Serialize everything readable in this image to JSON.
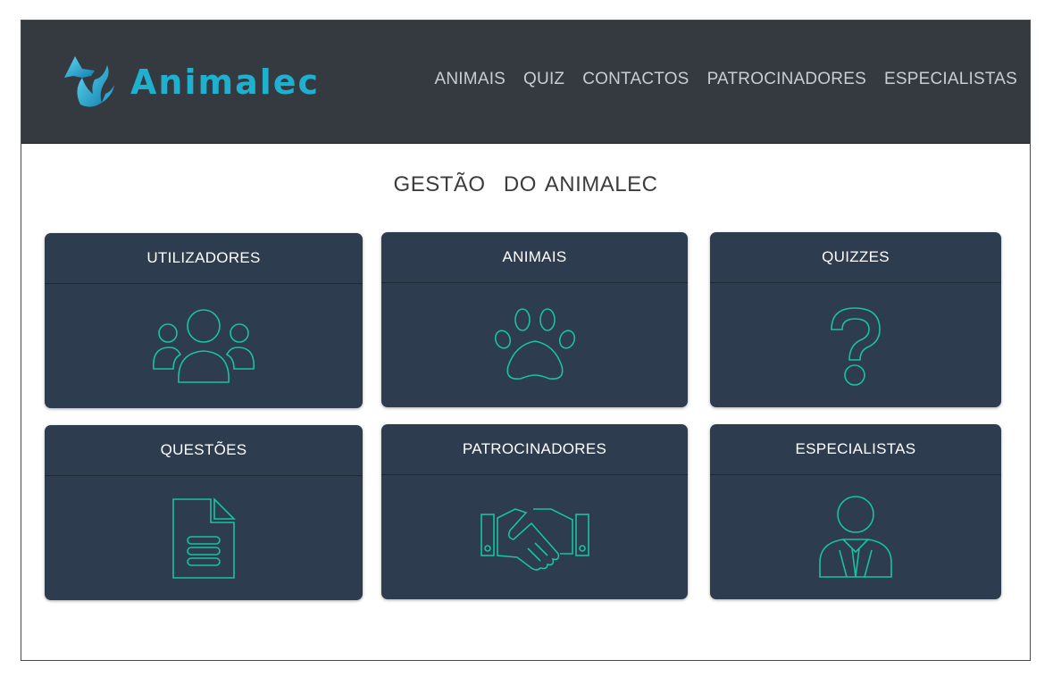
{
  "brand": {
    "name": "Animalec"
  },
  "nav": {
    "items": [
      {
        "label": "ANIMAIS"
      },
      {
        "label": "QUIZ"
      },
      {
        "label": "CONTACTOS"
      },
      {
        "label": "PATROCINADORES"
      },
      {
        "label": "ESPECIALISTAS"
      }
    ]
  },
  "main": {
    "title": "GESTÃO  DO ANIMALEC",
    "cards": [
      {
        "label": "UTILIZADORES",
        "icon": "users-icon"
      },
      {
        "label": "ANIMAIS",
        "icon": "paw-icon"
      },
      {
        "label": "QUIZZES",
        "icon": "question-mark-icon"
      },
      {
        "label": "QUESTÕES",
        "icon": "document-icon"
      },
      {
        "label": "PATROCINADORES",
        "icon": "handshake-icon"
      },
      {
        "label": "ESPECIALISTAS",
        "icon": "specialist-icon"
      }
    ]
  },
  "colors": {
    "navbar": "#343a40",
    "brand": "#1fb0d0",
    "card": "#2d3c4e",
    "icon_stroke": "#19c2a0"
  }
}
